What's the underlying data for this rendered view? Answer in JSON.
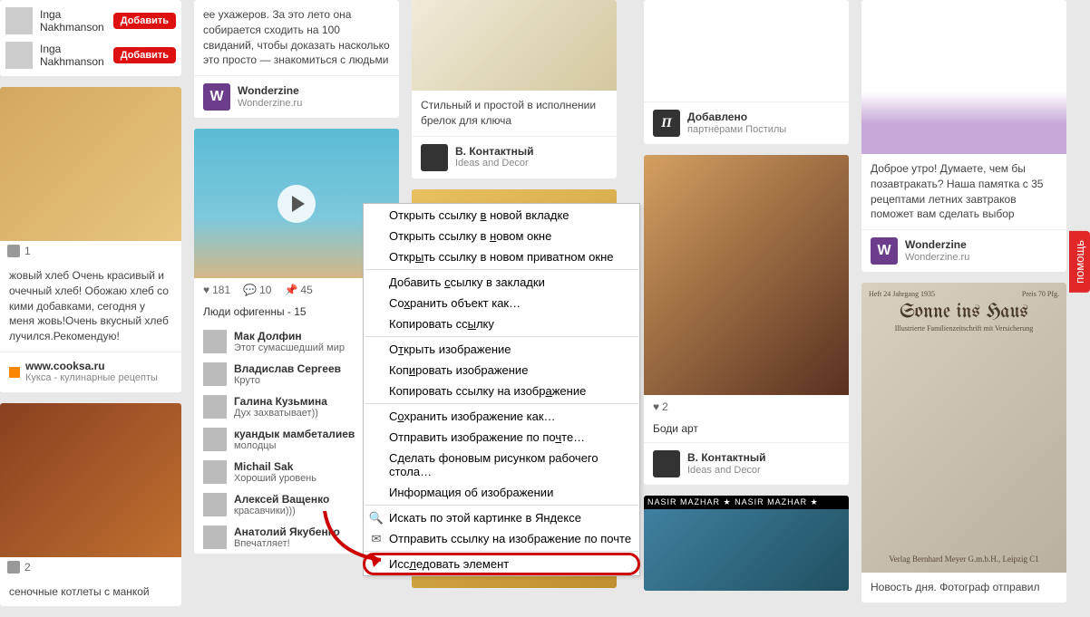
{
  "help_label": "помощь",
  "users": [
    {
      "name": "Inga Nakhmanson",
      "btn": "Добавить"
    },
    {
      "name": "Inga Nakhmanson",
      "btn": "Добавить"
    }
  ],
  "col1": {
    "card1": {
      "img_count": "1",
      "text": "жовый хлеб Очень красивый и очечный хлеб! Обожаю хлеб со кими добавками, сегодня у меня жовь!Очень вкусный хлеб лучился.Рекомендую!",
      "site": "www.cooksa.ru",
      "sitesub": "Кукса - кулинарные рецепты"
    },
    "card2": {
      "img_count": "2",
      "text": "сеночные котлеты с манкой"
    }
  },
  "col2": {
    "card0": {
      "text": "ее ухажеров. За это лето она собирается сходить на 100 свиданий, чтобы доказать насколько это просто — знакомиться с людьми",
      "name": "Wonderzine",
      "sub": "Wonderzine.ru"
    },
    "card1": {
      "likes": "181",
      "comments": "10",
      "pins": "45",
      "caption": "Люди офигенны - 15",
      "comlist": [
        {
          "name": "Мак Долфин",
          "text": "Этот сумасшедший мир"
        },
        {
          "name": "Владислав Сергеев",
          "text": "Круто"
        },
        {
          "name": "Галина Кузьмина",
          "text": "Дух захватывает))"
        },
        {
          "name": "куандык мамбеталиев",
          "text": "молодцы"
        },
        {
          "name": "Michail Sak",
          "text": "Хороший уровень"
        },
        {
          "name": "Алексей Ващенко",
          "text": "красавчики)))"
        },
        {
          "name": "Анатолий Якубенко",
          "text": "Впечатляет!"
        }
      ]
    }
  },
  "col3": {
    "card1": {
      "text": "Стильный и простой в исполнении брелок для ключа",
      "name": "В. Контактный",
      "sub": "Ideas and Decor"
    }
  },
  "col4": {
    "card1": {
      "name": "Добавлено",
      "sub": "партнёрами Постилы"
    },
    "card2": {
      "likes": "2",
      "caption": "Боди арт",
      "name": "В. Контактный",
      "sub": "Ideas and Decor"
    },
    "card3_banner": "NASIR MAZHAR ★ NASIR MAZHAR ★"
  },
  "col5": {
    "card1": {
      "text": "Доброе утро! Думаете, чем бы позавтракать? Наша памятка с 35 рецептами летних завтраков поможет вам сделать выбор",
      "name": "Wonderzine",
      "sub": "Wonderzine.ru"
    },
    "card2": {
      "title": "Sonne ins Haus",
      "subtitle": "Illustrierte Familienzeitschrift mit Versicherung",
      "header_left": "Heft 24 Jahrgang 1935",
      "header_right": "Preis 70 Pfg.",
      "publisher": "Verlag Bernhard Meyer G.m.b.H., Leipzig C1",
      "text": "Новость дня. Фотограф отправил"
    }
  },
  "context_menu": {
    "items": [
      {
        "html": "Открыть ссылку <u>в</u> новой вкладке"
      },
      {
        "html": "Открыть ссылку в <u>н</u>овом окне"
      },
      {
        "html": "Откр<u>ы</u>ть ссылку в новом приватном окне"
      },
      {
        "sep": true
      },
      {
        "html": "Добавить <u>с</u>сылку в закладки"
      },
      {
        "html": "Со<u>х</u>ранить объект как…"
      },
      {
        "html": "Копировать сс<u>ы</u>лку"
      },
      {
        "sep": true
      },
      {
        "html": "О<u>т</u>крыть изображение"
      },
      {
        "html": "Коп<u>и</u>ровать изображение"
      },
      {
        "html": "Копировать ссылку на изобр<u>а</u>жение"
      },
      {
        "sep": true
      },
      {
        "html": "С<u>о</u>хранить изображение как…"
      },
      {
        "html": "Отправить изображение по по<u>ч</u>те…"
      },
      {
        "html": "С<u>д</u>елать фоновым рисунком рабочего стола…"
      },
      {
        "html": "Информация об изображении"
      },
      {
        "sep": true
      },
      {
        "html": "Искать по этой картинке в Яндексе",
        "icon": "🔍"
      },
      {
        "html": "Отправить ссылку на изображение по почте",
        "icon": "✉"
      },
      {
        "sep": true
      },
      {
        "html": "Исс<u>л</u>едовать элемент",
        "hilite": true
      }
    ]
  }
}
